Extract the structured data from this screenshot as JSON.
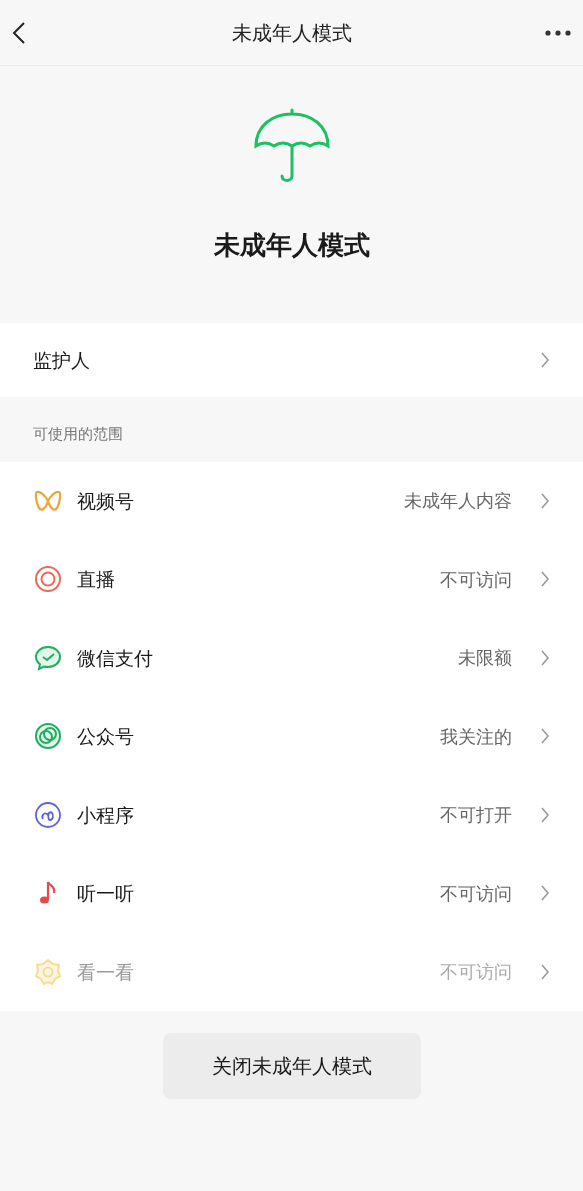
{
  "nav": {
    "title": "未成年人模式"
  },
  "hero": {
    "title": "未成年人模式"
  },
  "guardian": {
    "label": "监护人"
  },
  "section_label": "可使用的范围",
  "items": [
    {
      "kind": "channels",
      "label": "视频号",
      "value": "未成年人内容",
      "disabled": false
    },
    {
      "kind": "live",
      "label": "直播",
      "value": "不可访问",
      "disabled": false
    },
    {
      "kind": "pay",
      "label": "微信支付",
      "value": "未限额",
      "disabled": false
    },
    {
      "kind": "official",
      "label": "公众号",
      "value": "我关注的",
      "disabled": false
    },
    {
      "kind": "miniprogram",
      "label": "小程序",
      "value": "不可打开",
      "disabled": false
    },
    {
      "kind": "listen",
      "label": "听一听",
      "value": "不可访问",
      "disabled": false
    },
    {
      "kind": "look",
      "label": "看一看",
      "value": "不可访问",
      "disabled": true
    }
  ],
  "close_button": "关闭未成年人模式"
}
